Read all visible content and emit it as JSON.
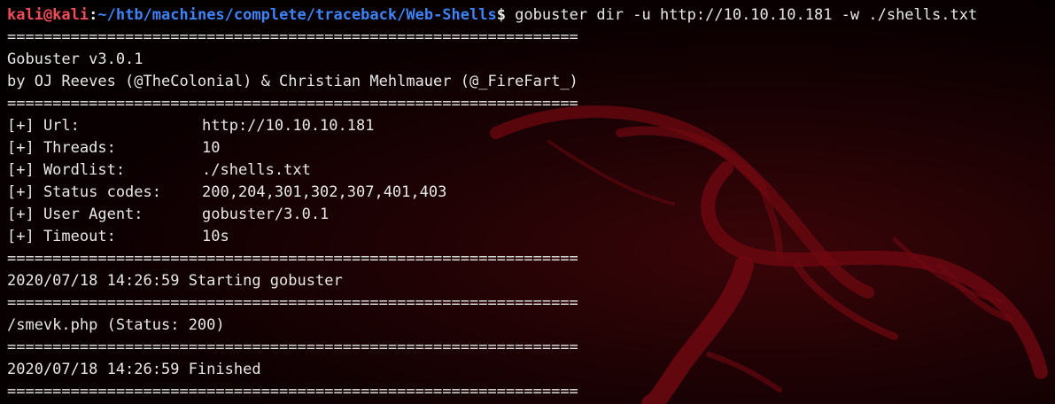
{
  "prompt": {
    "user_host": "kali@kali",
    "separator": ":",
    "path": "~/htb/machines/complete/traceback/Web-Shells",
    "symbol": "$",
    "command": " gobuster dir -u http://10.10.10.181 -w ./shells.txt"
  },
  "separator": "===============================================================",
  "banner": {
    "version": "Gobuster v3.0.1",
    "credits": "by OJ Reeves (@TheColonial) & Christian Mehlmauer (@_FireFart_)"
  },
  "config": [
    {
      "key": "[+] Url:",
      "value": "http://10.10.10.181"
    },
    {
      "key": "[+] Threads:",
      "value": "10"
    },
    {
      "key": "[+] Wordlist:",
      "value": "./shells.txt"
    },
    {
      "key": "[+] Status codes:",
      "value": "200,204,301,302,307,401,403"
    },
    {
      "key": "[+] User Agent:",
      "value": "gobuster/3.0.1"
    },
    {
      "key": "[+] Timeout:",
      "value": "10s"
    }
  ],
  "start_msg": "2020/07/18 14:26:59 Starting gobuster",
  "result": "/smevk.php (Status: 200)",
  "finish_msg": "2020/07/18 14:26:59 Finished",
  "colors": {
    "user": "#f24b59",
    "path": "#3f82f7",
    "text": "#e8e8e8",
    "logo": "#7a0a12"
  }
}
